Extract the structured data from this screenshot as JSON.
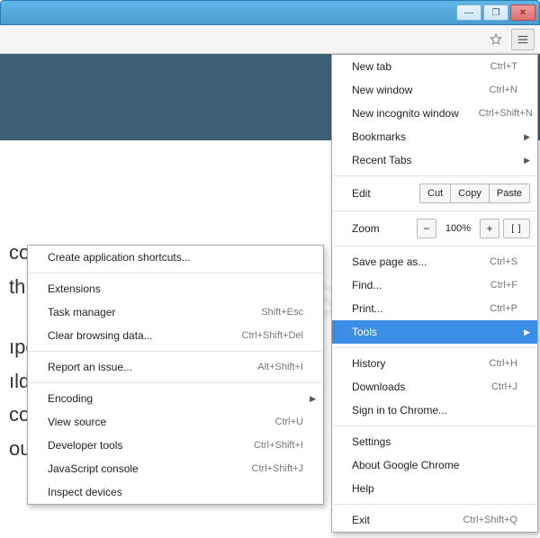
{
  "window": {
    "minimize": "—",
    "maximize": "❐",
    "close": "✕"
  },
  "page": {
    "line1": "co",
    "line2": "th",
    "line3": "ıpo",
    "line4": "ıld",
    "line5": "co",
    "line6": "ou"
  },
  "menu": {
    "new_tab": {
      "label": "New tab",
      "accel": "Ctrl+T"
    },
    "new_window": {
      "label": "New window",
      "accel": "Ctrl+N"
    },
    "new_incognito": {
      "label": "New incognito window",
      "accel": "Ctrl+Shift+N"
    },
    "bookmarks": {
      "label": "Bookmarks"
    },
    "recent_tabs": {
      "label": "Recent Tabs"
    },
    "edit": {
      "label": "Edit",
      "cut": "Cut",
      "copy": "Copy",
      "paste": "Paste"
    },
    "zoom": {
      "label": "Zoom",
      "value": "100%",
      "minus": "−",
      "plus": "+",
      "full": "[ ]"
    },
    "save_as": {
      "label": "Save page as...",
      "accel": "Ctrl+S"
    },
    "find": {
      "label": "Find...",
      "accel": "Ctrl+F"
    },
    "print": {
      "label": "Print...",
      "accel": "Ctrl+P"
    },
    "tools": {
      "label": "Tools"
    },
    "history": {
      "label": "History",
      "accel": "Ctrl+H"
    },
    "downloads": {
      "label": "Downloads",
      "accel": "Ctrl+J"
    },
    "signin": {
      "label": "Sign in to Chrome..."
    },
    "settings": {
      "label": "Settings"
    },
    "about": {
      "label": "About Google Chrome"
    },
    "help": {
      "label": "Help"
    },
    "exit": {
      "label": "Exit",
      "accel": "Ctrl+Shift+Q"
    }
  },
  "tools_sub": {
    "create_shortcuts": {
      "label": "Create application shortcuts..."
    },
    "extensions": {
      "label": "Extensions"
    },
    "task_manager": {
      "label": "Task manager",
      "accel": "Shift+Esc"
    },
    "clear_data": {
      "label": "Clear browsing data...",
      "accel": "Ctrl+Shift+Del"
    },
    "report_issue": {
      "label": "Report an issue...",
      "accel": "Alt+Shift+I"
    },
    "encoding": {
      "label": "Encoding"
    },
    "view_source": {
      "label": "View source",
      "accel": "Ctrl+U"
    },
    "dev_tools": {
      "label": "Developer tools",
      "accel": "Ctrl+Shift+I"
    },
    "js_console": {
      "label": "JavaScript console",
      "accel": "Ctrl+Shift+J"
    },
    "inspect_devices": {
      "label": "Inspect devices"
    }
  }
}
